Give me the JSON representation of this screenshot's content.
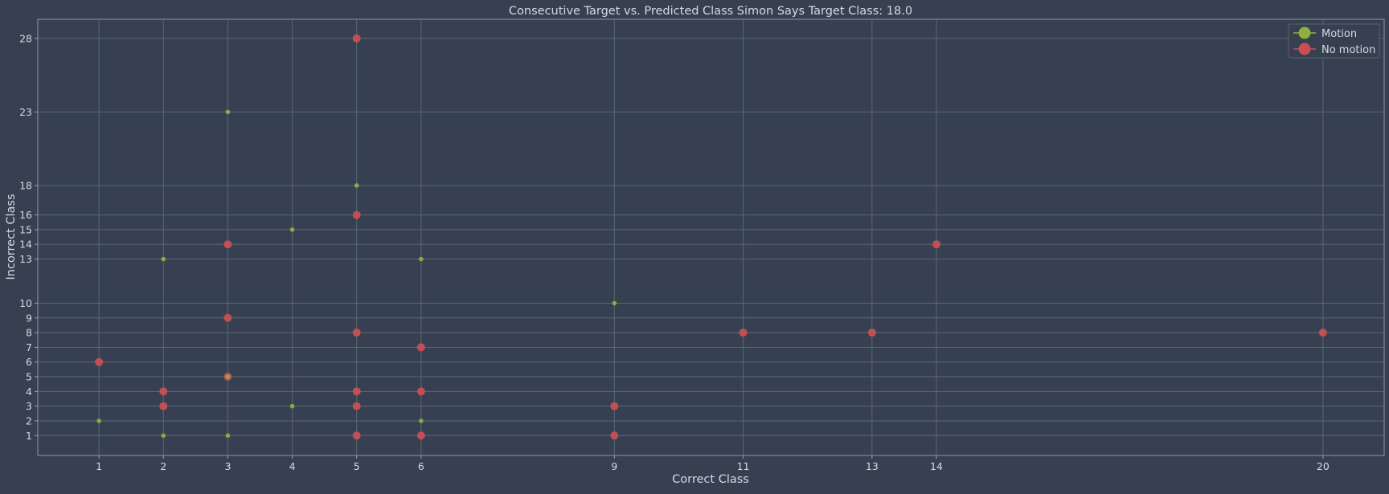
{
  "chart_data": {
    "type": "scatter",
    "title": "Consecutive Target vs. Predicted Class Simon Says Target Class: 18.0",
    "xlabel": "Correct Class",
    "ylabel": "Incorrect Class",
    "xlim": [
      0.05,
      20.95
    ],
    "ylim": [
      -0.35,
      29.3
    ],
    "x_ticks": [
      1,
      2,
      3,
      4,
      5,
      6,
      9,
      11,
      13,
      14,
      20
    ],
    "y_ticks": [
      1,
      2,
      3,
      4,
      5,
      6,
      7,
      8,
      9,
      10,
      13,
      14,
      15,
      16,
      18,
      23,
      28
    ],
    "grid": true,
    "legend_position": "top-right",
    "series": [
      {
        "name": "Motion",
        "color": "#8fb03c",
        "marker_size": "small",
        "points": [
          [
            1,
            2
          ],
          [
            2,
            1
          ],
          [
            2,
            13
          ],
          [
            3,
            1
          ],
          [
            3,
            5
          ],
          [
            3,
            23
          ],
          [
            4,
            3
          ],
          [
            4,
            15
          ],
          [
            5,
            18
          ],
          [
            6,
            2
          ],
          [
            6,
            13
          ],
          [
            9,
            10
          ]
        ]
      },
      {
        "name": "No motion",
        "color": "#c94f55",
        "marker_size": "large",
        "points": [
          [
            1,
            6
          ],
          [
            2,
            3
          ],
          [
            2,
            4
          ],
          [
            3,
            5
          ],
          [
            3,
            9
          ],
          [
            3,
            14
          ],
          [
            5,
            1
          ],
          [
            5,
            3
          ],
          [
            5,
            4
          ],
          [
            5,
            8
          ],
          [
            5,
            16
          ],
          [
            5,
            28
          ],
          [
            6,
            1
          ],
          [
            6,
            4
          ],
          [
            6,
            7
          ],
          [
            9,
            1
          ],
          [
            9,
            3
          ],
          [
            11,
            8
          ],
          [
            13,
            8
          ],
          [
            14,
            14
          ],
          [
            20,
            8
          ]
        ]
      }
    ]
  }
}
